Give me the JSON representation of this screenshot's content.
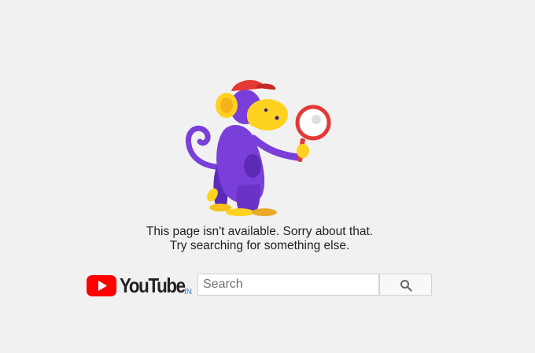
{
  "error": {
    "line1": "This page isn't available. Sorry about that.",
    "line2": "Try searching for something else."
  },
  "logo": {
    "text": "YouTube",
    "country_code": "IN"
  },
  "search": {
    "placeholder": "Search",
    "value": ""
  },
  "icons": {
    "illustration": "monkey-with-magnifier-illustration",
    "logo_play": "youtube-play-icon",
    "search": "search-icon"
  },
  "colors": {
    "brand_red": "#ff0000",
    "monkey_purple": "#7a3fd8",
    "monkey_yellow": "#ffd21f",
    "cap_red": "#e53935",
    "background": "#f1f1f1"
  }
}
